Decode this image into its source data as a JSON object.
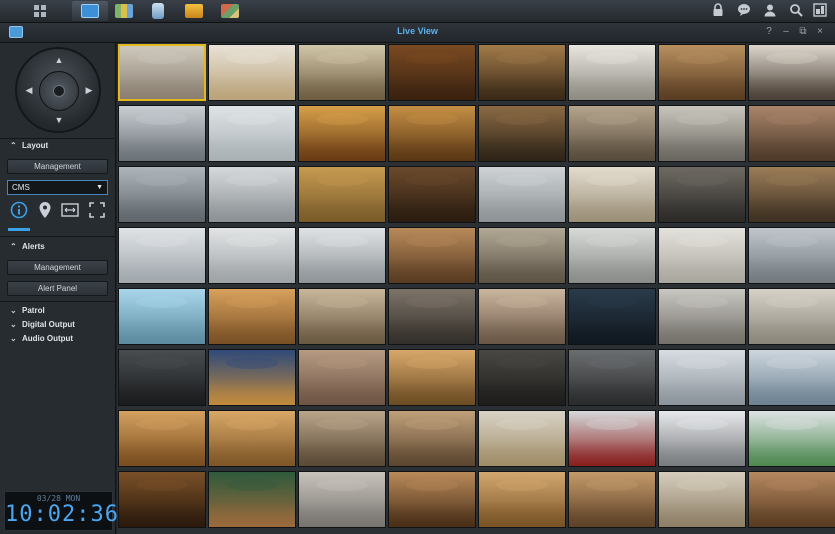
{
  "taskbar": {
    "apps": [
      {
        "icon": "main-menu-icon",
        "color": "#9aa3ad"
      },
      {
        "icon": "live-view-icon",
        "color": "#3d8fd6",
        "active": true
      },
      {
        "icon": "timeline-icon",
        "color": "#7fb36a"
      },
      {
        "icon": "camera-icon",
        "color": "#8fb2cf"
      },
      {
        "icon": "recording-icon",
        "color": "#e0a21e"
      },
      {
        "icon": "map-icon",
        "color": "#d06a4a"
      }
    ],
    "right_icons": [
      "lock-icon",
      "chat-icon",
      "user-icon",
      "search-icon",
      "windows-icon"
    ]
  },
  "window": {
    "title": "Live View",
    "controls": [
      "?",
      "–",
      "⧉",
      "×"
    ]
  },
  "sidebar": {
    "layout_header": "Layout",
    "layout_management": "Management",
    "layout_select": "CMS",
    "tools": [
      "info-icon",
      "location-icon",
      "fit-icon",
      "fullscreen-icon"
    ],
    "alerts_header": "Alerts",
    "alerts_management": "Management",
    "alert_panel": "Alert Panel",
    "patrol": "Patrol",
    "digital_output": "Digital Output",
    "audio_output": "Audio Output"
  },
  "clock": {
    "date": "03/28 MON",
    "time": "10:02:36"
  },
  "grid": {
    "rows": 8,
    "cols": 8,
    "selected_index": 0,
    "palettes": [
      [
        "#cfc9bd",
        "#8a7f70"
      ],
      [
        "#e8e2d6",
        "#b9a37a"
      ],
      [
        "#d2c7aa",
        "#6f5d40"
      ],
      [
        "#7a4a22",
        "#3a2210"
      ],
      [
        "#a17b4a",
        "#3b2a18"
      ],
      [
        "#e9e6df",
        "#8f8c84"
      ],
      [
        "#b89060",
        "#5a3d22"
      ],
      [
        "#dcd6cc",
        "#4b4036"
      ],
      [
        "#c9ced3",
        "#6b7278"
      ],
      [
        "#dfe4e6",
        "#a9b1b5"
      ],
      [
        "#d7a04a",
        "#6a3c14"
      ],
      [
        "#c58f44",
        "#5b3815"
      ],
      [
        "#8b6a44",
        "#2e2418"
      ],
      [
        "#b5a58e",
        "#574b3b"
      ],
      [
        "#c9c6bd",
        "#6a6760"
      ],
      [
        "#a9856a",
        "#4e3a2a"
      ],
      [
        "#aeb5bb",
        "#5f666c"
      ],
      [
        "#d6d9db",
        "#8c9296"
      ],
      [
        "#c69a50",
        "#7a5c2a"
      ],
      [
        "#6b4a2c",
        "#2a1c10"
      ],
      [
        "#cfd3d5",
        "#8d9396"
      ],
      [
        "#e4ddcf",
        "#9b8f78"
      ],
      [
        "#6e6a63",
        "#2d2b28"
      ],
      [
        "#9c7d58",
        "#3e3122"
      ],
      [
        "#dfe3e6",
        "#a1a8ad"
      ],
      [
        "#e2e4e5",
        "#9ea3a6"
      ],
      [
        "#e0e3e5",
        "#8f9599"
      ],
      [
        "#b88a5a",
        "#5a3c22"
      ],
      [
        "#b2a896",
        "#5d5446"
      ],
      [
        "#d8dad8",
        "#8a8c8a"
      ],
      [
        "#e4e2dc",
        "#aaa79f"
      ],
      [
        "#c0c6cb",
        "#727a80"
      ],
      [
        "#a9d6ea",
        "#5d8ca0"
      ],
      [
        "#d8a15c",
        "#7a5126"
      ],
      [
        "#c9b79c",
        "#6b5a42"
      ],
      [
        "#7d7469",
        "#332f2a"
      ],
      [
        "#cbb6a0",
        "#6a5745"
      ],
      [
        "#2a3b4a",
        "#101820"
      ],
      [
        "#c9c7c2",
        "#74716b"
      ],
      [
        "#d6d2c8",
        "#8c877b"
      ],
      [
        "#4a4d50",
        "#1a1c1e"
      ],
      [
        "#2f4a7a",
        "#c08a3e"
      ],
      [
        "#b69a82",
        "#6e5544"
      ],
      [
        "#d8a86a",
        "#6d4d24"
      ],
      [
        "#4a4845",
        "#1e1d1b"
      ],
      [
        "#6b6e70",
        "#2b2c2d"
      ],
      [
        "#d7dde2",
        "#8d959c"
      ],
      [
        "#cdd7de",
        "#6d8293"
      ],
      [
        "#d4a160",
        "#7a4e1f"
      ],
      [
        "#d9a867",
        "#7f5728"
      ],
      [
        "#b9a58a",
        "#5b4a36"
      ],
      [
        "#c0a07a",
        "#5d4730"
      ],
      [
        "#d9d3c6",
        "#a08e68"
      ],
      [
        "#d7d8d9",
        "#8a2020"
      ],
      [
        "#e6e8ea",
        "#7a7d80"
      ],
      [
        "#dde3e3",
        "#4f8a52"
      ],
      [
        "#7a5028",
        "#2c1a0c"
      ],
      [
        "#2f5a3c",
        "#9a6a3c"
      ],
      [
        "#c8c4bc",
        "#787470"
      ],
      [
        "#b98a5a",
        "#4a3018"
      ],
      [
        "#d3a870",
        "#7a5426"
      ],
      [
        "#c49a6a",
        "#5e4228"
      ],
      [
        "#d6cdbd",
        "#8e7f66"
      ],
      [
        "#b58860",
        "#5a3c22"
      ]
    ]
  }
}
